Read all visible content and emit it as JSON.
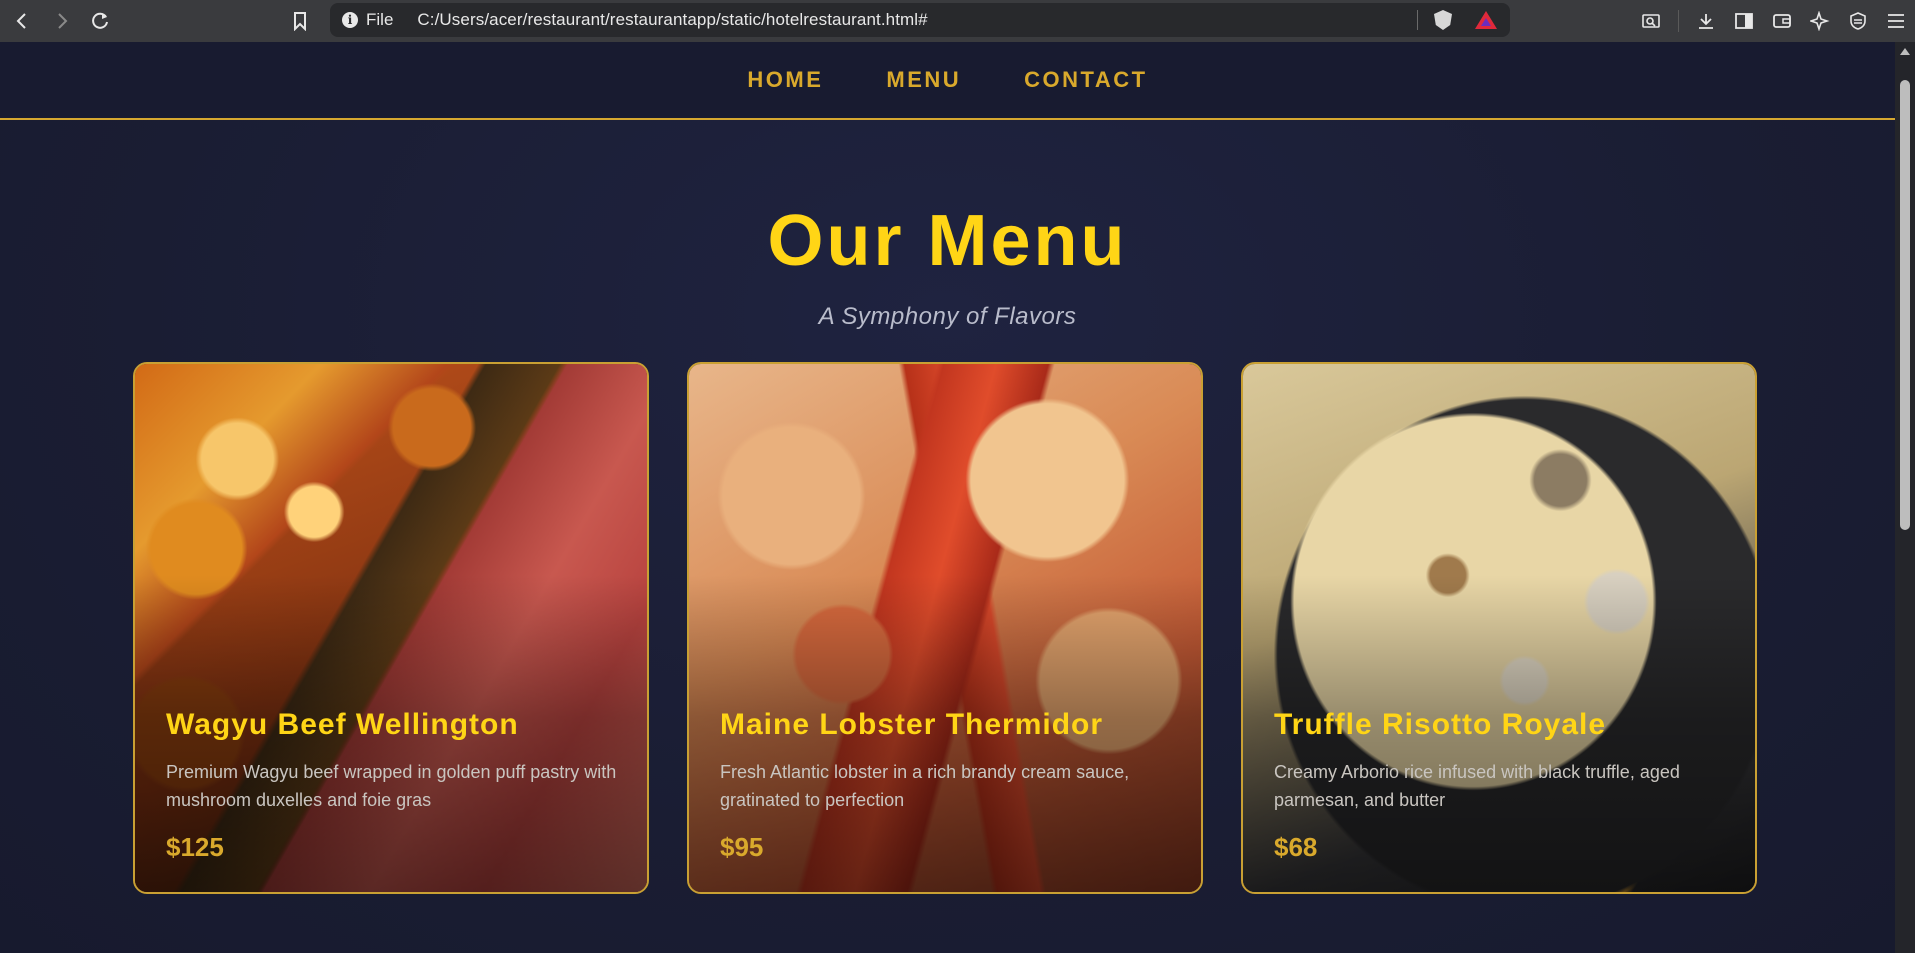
{
  "browser": {
    "url_scheme": "File",
    "url": "C:/Users/acer/restaurant/restaurantapp/static/hotelrestaurant.html#",
    "icons": {
      "back": "chevron-left-icon",
      "forward": "chevron-right-icon",
      "reload": "reload-icon",
      "bookmark": "bookmark-icon",
      "info": "info-icon",
      "shields": "brave-shield-icon",
      "rewards": "brave-rewards-icon",
      "right_tools": [
        "screenshot-icon",
        "download-icon",
        "sidebar-icon",
        "wallet-icon",
        "leo-ai-icon",
        "vpn-icon",
        "menu-icon"
      ]
    }
  },
  "site": {
    "nav": [
      {
        "label": "HOME"
      },
      {
        "label": "MENU"
      },
      {
        "label": "CONTACT"
      }
    ],
    "hero": {
      "title": "Our Menu",
      "subtitle": "A Symphony of Flavors"
    },
    "menu_items": [
      {
        "name": "Wagyu Beef Wellington",
        "description": "Premium Wagyu beef wrapped in golden puff pastry with mushroom duxelles and foie gras",
        "price": "$125"
      },
      {
        "name": "Maine Lobster Thermidor",
        "description": "Fresh Atlantic lobster in a rich brandy cream sauce, gratinated to perfection",
        "price": "$95"
      },
      {
        "name": "Truffle Risotto Royale",
        "description": "Creamy Arborio rice infused with black truffle, aged parmesan, and butter",
        "price": "$68"
      }
    ]
  },
  "colors": {
    "background": "#1a1d33",
    "gold": "#ffd516",
    "nav_gold": "#d9a92c",
    "card_border": "#c9a033",
    "subtitle": "#b9bccb"
  }
}
